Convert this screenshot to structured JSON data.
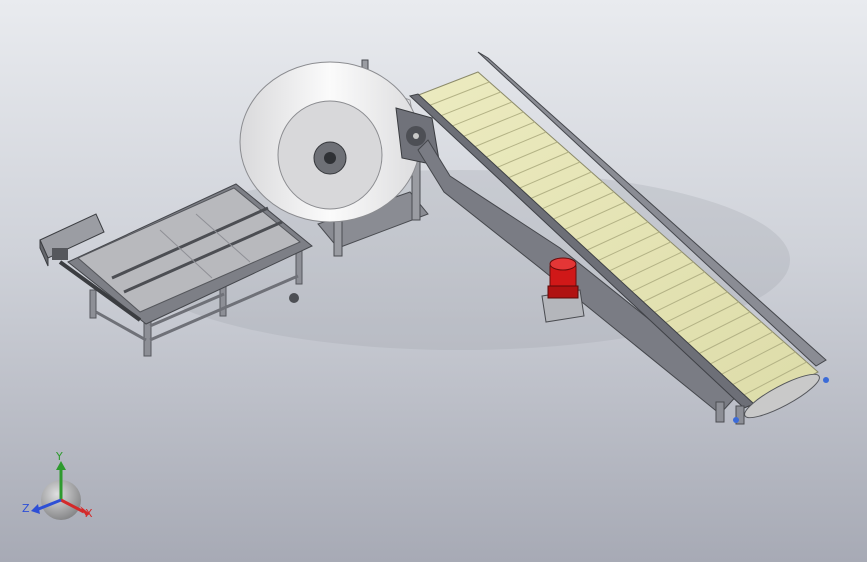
{
  "viewport": {
    "background_top": "#e9ebef",
    "background_bottom": "#a7aab5"
  },
  "model": {
    "parts": [
      "feed-conveyor",
      "paper-roll",
      "roll-stand",
      "inclined-conveyor",
      "drive-motor"
    ],
    "colors": {
      "belt": "#e6e4b4",
      "frame": "#9a9ca3",
      "roll": "#f1f1f1",
      "motor": "#d01818"
    }
  },
  "triad": {
    "x_label": "X",
    "y_label": "Y",
    "z_label": "Z",
    "x_color": "#d42a2a",
    "y_color": "#2e9a2e",
    "z_color": "#2d4fd6"
  }
}
